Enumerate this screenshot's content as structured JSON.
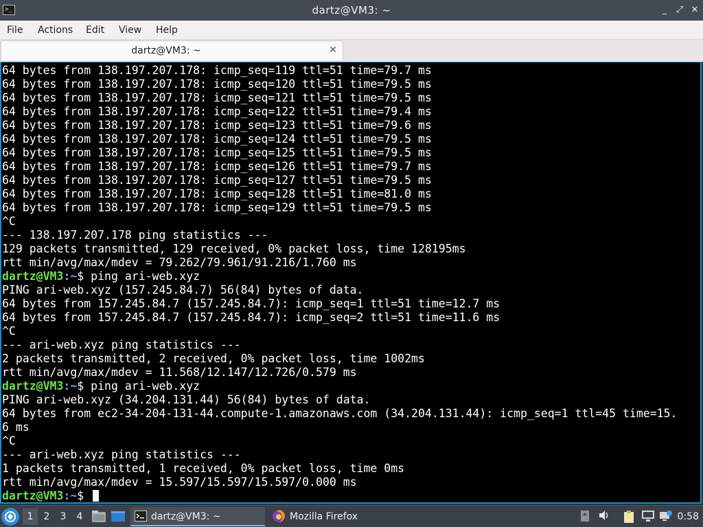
{
  "window": {
    "title": "dartz@VM3: ~",
    "controls": {
      "minimize": "_",
      "maximize": "⤢",
      "close": "✕"
    }
  },
  "menubar": {
    "items": [
      {
        "label": "File"
      },
      {
        "label": "Actions"
      },
      {
        "label": "Edit"
      },
      {
        "label": "View"
      },
      {
        "label": "Help"
      }
    ]
  },
  "tabs": [
    {
      "label": "dartz@VM3: ~",
      "close": "✕"
    }
  ],
  "terminal": {
    "prompt_user": "dartz@VM3",
    "prompt_path": "~",
    "lines": [
      {
        "type": "out",
        "text": "64 bytes from 138.197.207.178: icmp_seq=119 ttl=51 time=79.7 ms"
      },
      {
        "type": "out",
        "text": "64 bytes from 138.197.207.178: icmp_seq=120 ttl=51 time=79.5 ms"
      },
      {
        "type": "out",
        "text": "64 bytes from 138.197.207.178: icmp_seq=121 ttl=51 time=79.5 ms"
      },
      {
        "type": "out",
        "text": "64 bytes from 138.197.207.178: icmp_seq=122 ttl=51 time=79.4 ms"
      },
      {
        "type": "out",
        "text": "64 bytes from 138.197.207.178: icmp_seq=123 ttl=51 time=79.6 ms"
      },
      {
        "type": "out",
        "text": "64 bytes from 138.197.207.178: icmp_seq=124 ttl=51 time=79.5 ms"
      },
      {
        "type": "out",
        "text": "64 bytes from 138.197.207.178: icmp_seq=125 ttl=51 time=79.5 ms"
      },
      {
        "type": "out",
        "text": "64 bytes from 138.197.207.178: icmp_seq=126 ttl=51 time=79.7 ms"
      },
      {
        "type": "out",
        "text": "64 bytes from 138.197.207.178: icmp_seq=127 ttl=51 time=79.5 ms"
      },
      {
        "type": "out",
        "text": "64 bytes from 138.197.207.178: icmp_seq=128 ttl=51 time=81.0 ms"
      },
      {
        "type": "out",
        "text": "64 bytes from 138.197.207.178: icmp_seq=129 ttl=51 time=79.5 ms"
      },
      {
        "type": "out",
        "text": "^C"
      },
      {
        "type": "out",
        "text": "--- 138.197.207.178 ping statistics ---"
      },
      {
        "type": "out",
        "text": "129 packets transmitted, 129 received, 0% packet loss, time 128195ms"
      },
      {
        "type": "out",
        "text": "rtt min/avg/max/mdev = 79.262/79.961/91.216/1.760 ms"
      },
      {
        "type": "prompt",
        "command": "ping ari-web.xyz"
      },
      {
        "type": "out",
        "text": "PING ari-web.xyz (157.245.84.7) 56(84) bytes of data."
      },
      {
        "type": "out",
        "text": "64 bytes from 157.245.84.7 (157.245.84.7): icmp_seq=1 ttl=51 time=12.7 ms"
      },
      {
        "type": "out",
        "text": "64 bytes from 157.245.84.7 (157.245.84.7): icmp_seq=2 ttl=51 time=11.6 ms"
      },
      {
        "type": "out",
        "text": "^C"
      },
      {
        "type": "out",
        "text": "--- ari-web.xyz ping statistics ---"
      },
      {
        "type": "out",
        "text": "2 packets transmitted, 2 received, 0% packet loss, time 1002ms"
      },
      {
        "type": "out",
        "text": "rtt min/avg/max/mdev = 11.568/12.147/12.726/0.579 ms"
      },
      {
        "type": "prompt",
        "command": "ping ari-web.xyz"
      },
      {
        "type": "out",
        "text": "PING ari-web.xyz (34.204.131.44) 56(84) bytes of data."
      },
      {
        "type": "out",
        "text": "64 bytes from ec2-34-204-131-44.compute-1.amazonaws.com (34.204.131.44): icmp_seq=1 ttl=45 time=15."
      },
      {
        "type": "out",
        "text": "6 ms"
      },
      {
        "type": "out",
        "text": "^C"
      },
      {
        "type": "out",
        "text": "--- ari-web.xyz ping statistics ---"
      },
      {
        "type": "out",
        "text": "1 packets transmitted, 1 received, 0% packet loss, time 0ms"
      },
      {
        "type": "out",
        "text": "rtt min/avg/max/mdev = 15.597/15.597/15.597/0.000 ms"
      },
      {
        "type": "prompt",
        "command": "",
        "cursor": true
      }
    ]
  },
  "taskbar": {
    "start_icon": "lxqt-menu-icon",
    "workspaces": [
      {
        "label": "1",
        "active": true
      },
      {
        "label": "2",
        "active": false
      },
      {
        "label": "3",
        "active": false
      },
      {
        "label": "4",
        "active": false
      }
    ],
    "quicklaunch": [
      {
        "icon": "file-manager-icon"
      },
      {
        "icon": "show-desktop-icon"
      }
    ],
    "tasks": [
      {
        "label": "dartz@VM3: ~",
        "icon": "terminal-icon",
        "active": true
      },
      {
        "label": "Mozilla Firefox",
        "icon": "firefox-icon",
        "active": false
      }
    ],
    "tray": [
      {
        "icon": "upload-icon"
      },
      {
        "icon": "volume-icon"
      },
      {
        "icon": "clipboard-icon"
      },
      {
        "icon": "network-icon"
      },
      {
        "icon": "update-icon"
      }
    ],
    "clock": "0:58"
  }
}
